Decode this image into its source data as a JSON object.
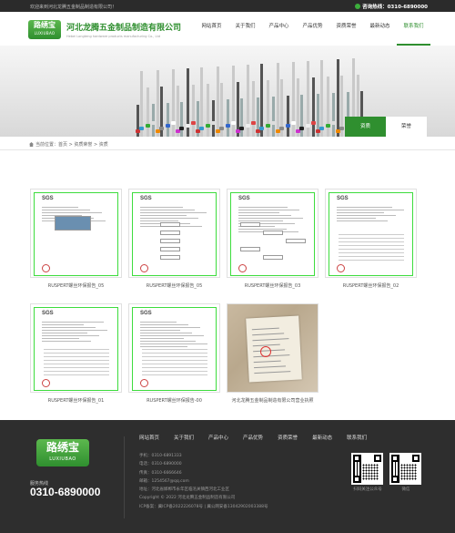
{
  "topbar": {
    "welcome": "欢迎来到河北龙腾五金制品制造有限公司！",
    "hotline": "咨询热线：0310-6890000"
  },
  "header": {
    "logo_cn": "路绣宝",
    "logo_en": "LUXIUBAO",
    "company_cn": "河北龙腾五金制品制造有限公司",
    "company_en": "Hebei Longteng hardware products manufacturing Co., Ltd",
    "nav": [
      "网站首页",
      "关于我们",
      "产品中心",
      "产品优势",
      "资质荣誉",
      "最新动态",
      "联系我们"
    ],
    "active_nav": "联系我们"
  },
  "banner": {
    "tabs": [
      "资质",
      "荣誉"
    ],
    "active_tab": "资质"
  },
  "breadcrumb": {
    "label": "当前位置：",
    "items": [
      "首页",
      "资质荣誉",
      "资质"
    ],
    "separator": " > "
  },
  "cards": [
    {
      "caption": "RUSPERT螺丝环保报告_05",
      "kind": "sgs-a"
    },
    {
      "caption": "RUSPERT螺丝环保报告_05",
      "kind": "sgs-b"
    },
    {
      "caption": "RUSPERT螺丝环保报告_03",
      "kind": "sgs-c"
    },
    {
      "caption": "RUSPERT螺丝环保报告_02",
      "kind": "sgs-d"
    },
    {
      "caption": "RUSPERT螺丝环保报告_01",
      "kind": "sgs-e"
    },
    {
      "caption": "RUSPERT螺丝环保报告-00",
      "kind": "sgs-f"
    },
    {
      "caption": "河北龙腾五金制品制造有限公司营业执照",
      "kind": "license"
    }
  ],
  "footer": {
    "logo_cn": "路绣宝",
    "logo_en": "LUXIUBAO",
    "hotline_label": "服务热线",
    "hotline": "0310-6890000",
    "nav": [
      "网站首页",
      "关于我们",
      "产品中心",
      "产品优势",
      "资质荣誉",
      "最新动态",
      "联系我们"
    ],
    "info": [
      "手机：0310-6891333",
      "电话：0310-6890000",
      "传真：0310-6666646",
      "邮箱：1254567@qq.com",
      "地址：河北省邯郸市永年区临洺关镇西河北工业区",
      "Copyright © 2022 河北龙腾五金制品制造有限公司",
      "ICP备案：冀ICP备2022226078号 | 冀公网安备13042902003388号"
    ],
    "qr_captions": [
      "扫码关注公众号",
      "微信"
    ]
  },
  "colors": {
    "brand_green": "#2f8f2f",
    "doc_border": "#3ddc3d",
    "footer_bg": "#2e2e2e"
  }
}
